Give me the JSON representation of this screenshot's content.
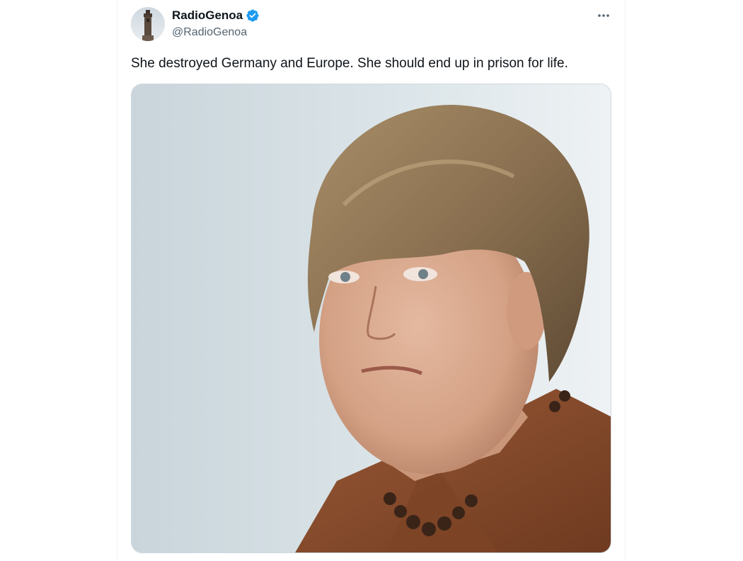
{
  "tweet": {
    "author": {
      "display_name": "RadioGenoa",
      "handle": "@RadioGenoa",
      "verified": true,
      "avatar_icon": "tower-photo"
    },
    "text": "She destroyed Germany and Europe. She should end up in prison for life.",
    "more_icon": "ellipsis-icon",
    "media": {
      "type": "photo",
      "subject": "portrait of a woman with short blonde-brown hair wearing a brown jacket and beaded necklace"
    }
  },
  "colors": {
    "verified_blue": "#1d9bf0",
    "text_primary": "#0f1419",
    "text_secondary": "#536471",
    "border": "#cfd9de"
  }
}
